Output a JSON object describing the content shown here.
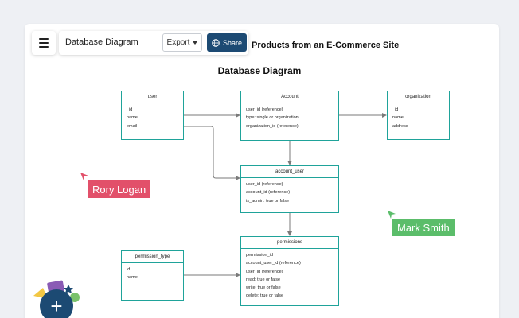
{
  "toolbar": {
    "document_title": "Database Diagram",
    "export_label": "Export",
    "share_label": "Share"
  },
  "page_header": "Products from an E-Commerce Site",
  "diagram": {
    "title": "Database Diagram",
    "entities": {
      "user": {
        "title": "user",
        "fields": [
          "_id",
          "name",
          "email"
        ]
      },
      "account": {
        "title": "Account",
        "fields": [
          "user_id (reference)",
          "type: single or organization",
          "organization_id (reference)"
        ]
      },
      "organization": {
        "title": "organization",
        "fields": [
          "_id",
          "name",
          "address"
        ]
      },
      "account_user": {
        "title": "account_user",
        "fields": [
          "user_id (reference)",
          "account_id (reference)",
          "is_admin: true or false"
        ]
      },
      "permission_type": {
        "title": "permission_type",
        "fields": [
          "id",
          "name"
        ]
      },
      "permissions": {
        "title": "permissions",
        "fields": [
          "permission_id",
          "account_user_id (reference)",
          "user_id (reference)",
          "read: true or false",
          "write: true or false",
          "delete: true or false"
        ]
      }
    }
  },
  "collaborators": [
    {
      "name": "Rory Logan",
      "color": "#e2506a"
    },
    {
      "name": "Mark Smith",
      "color": "#5bbd6a"
    }
  ],
  "colors": {
    "accent": "#1c4a73",
    "entity_border": "#1fa39a",
    "connector": "#7a7a7a"
  },
  "icons": {
    "menu": "hamburger-icon",
    "export_caret": "caret-down-icon",
    "share": "globe-icon",
    "fab": "plus-icon"
  }
}
